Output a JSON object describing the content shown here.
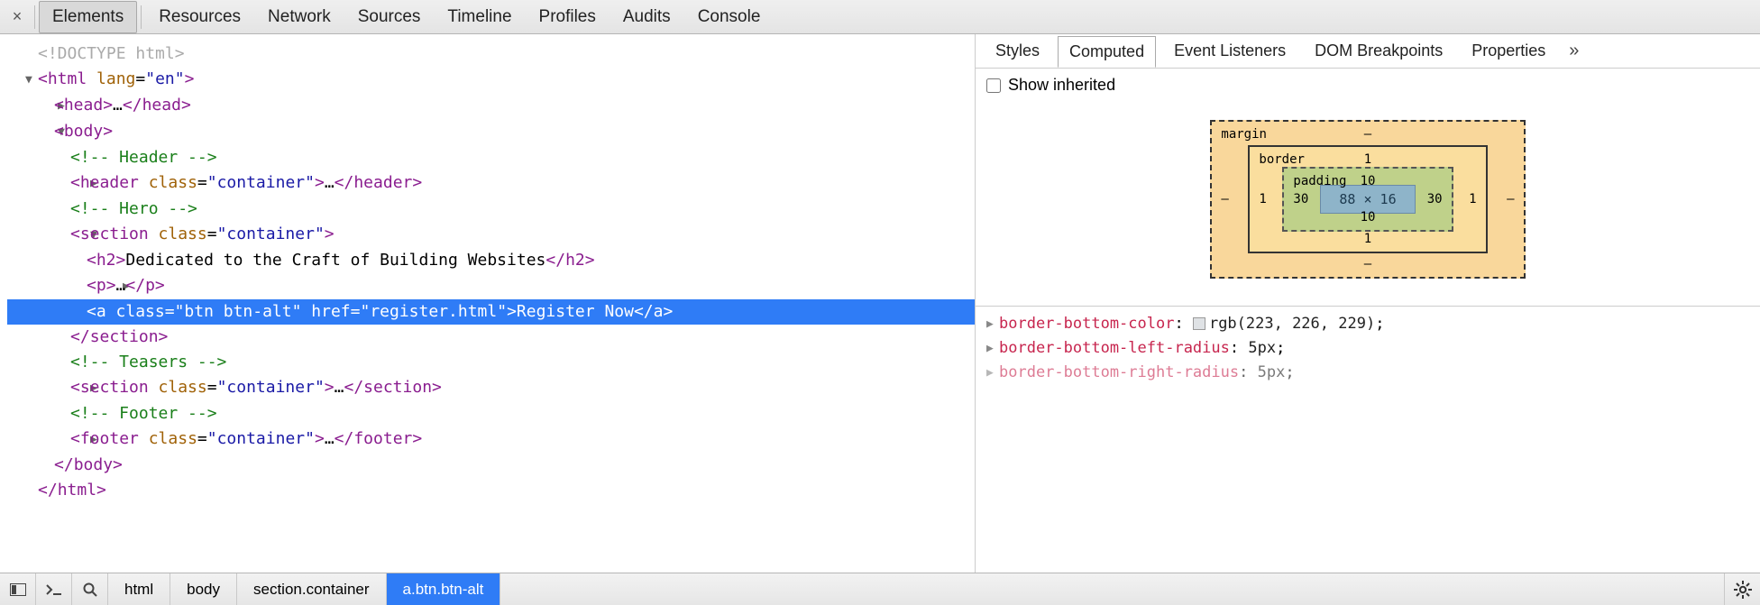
{
  "toolbar": {
    "tabs": [
      "Elements",
      "Resources",
      "Network",
      "Sources",
      "Timeline",
      "Profiles",
      "Audits",
      "Console"
    ],
    "active_index": 0
  },
  "dom": {
    "doctype": "<!DOCTYPE html>",
    "html_open": "html",
    "html_lang_attr": "lang",
    "html_lang_val": "\"en\"",
    "head": "head",
    "body": "body",
    "cmt_header": "<!-- Header -->",
    "header_tag": "header",
    "class_attr": "class",
    "container_val": "\"container\"",
    "cmt_hero": "<!-- Hero -->",
    "section_tag": "section",
    "h2_tag": "h2",
    "h2_text": "Dedicated to the Craft of Building Websites",
    "p_tag": "p",
    "a_tag": "a",
    "a_class_val": "\"btn btn-alt\"",
    "href_attr": "href",
    "href_val": "\"register.html\"",
    "a_text": "Register Now",
    "cmt_teasers": "<!-- Teasers -->",
    "cmt_footer": "<!-- Footer -->",
    "footer_tag": "footer",
    "ellipsis": "…"
  },
  "right": {
    "tabs": [
      "Styles",
      "Computed",
      "Event Listeners",
      "DOM Breakpoints",
      "Properties"
    ],
    "active_index": 1,
    "show_inherited_label": "Show inherited"
  },
  "box_model": {
    "margin_label": "margin",
    "border_label": "border",
    "padding_label": "padding",
    "margin": {
      "top": "–",
      "right": "–",
      "bottom": "–",
      "left": "–"
    },
    "border": {
      "top": "1",
      "right": "1",
      "bottom": "1",
      "left": "1"
    },
    "padding": {
      "top": "10",
      "right": "30",
      "bottom": "10",
      "left": "30"
    },
    "content": "88 × 16"
  },
  "computed_props": [
    {
      "name": "border-bottom-color",
      "value": "rgb(223, 226, 229)",
      "swatch": true
    },
    {
      "name": "border-bottom-left-radius",
      "value": "5px",
      "swatch": false
    },
    {
      "name": "border-bottom-right-radius",
      "value": "5px",
      "swatch": false
    }
  ],
  "breadcrumbs": {
    "items": [
      "html",
      "body",
      "section.container",
      "a.btn.btn-alt"
    ],
    "active_index": 3
  }
}
